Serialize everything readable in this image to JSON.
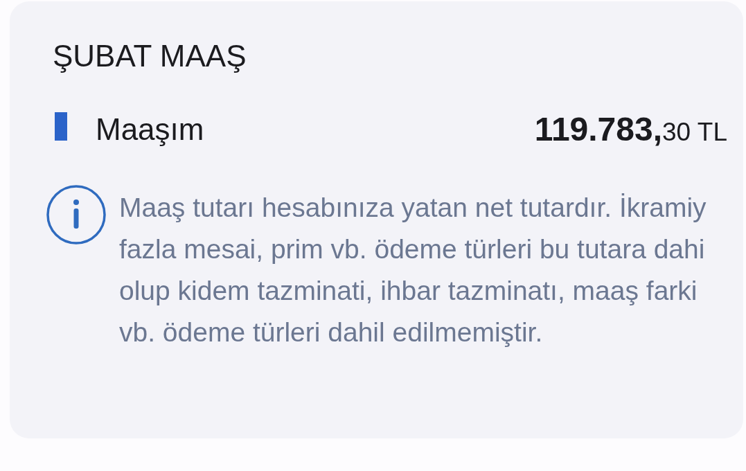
{
  "card": {
    "title": "ŞUBAT MAAŞ"
  },
  "items": [
    {
      "label": "Maaşım",
      "amount": "**119.783,**30 TL",
      "color": "#2b63c9"
    }
  ],
  "info": {
    "lines": [
      "Maaş tutarı hesabınıza yatan net tutardır. İkramiy",
      "fazla mesai, prim vb. ödeme türleri bu tutara dahi",
      "olup kidem tazminati, ihbar tazminatı, maaş farki",
      "vb. ödeme türleri dahil edilmemiştir."
    ]
  }
}
